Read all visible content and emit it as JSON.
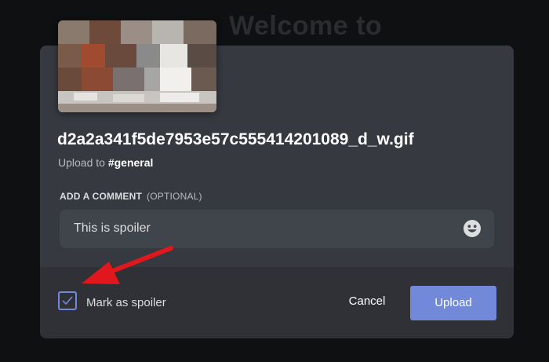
{
  "background": {
    "title": "Welcome to"
  },
  "upload": {
    "filename": "d2a2a341f5de7953e57c555414201089_d_w.gif",
    "destination_prefix": "Upload to",
    "destination_channel": "#general"
  },
  "comment": {
    "label": "ADD A COMMENT",
    "optional_label": "(OPTIONAL)",
    "value": "This is spoiler",
    "emoji_icon": "smiley-emoji-icon"
  },
  "spoiler": {
    "label": "Mark as spoiler",
    "checked": true
  },
  "actions": {
    "cancel_label": "Cancel",
    "upload_label": "Upload"
  },
  "colors": {
    "accent": "#7289da",
    "annotation_arrow": "#e0171c",
    "modal_bg": "#36393f",
    "footer_bg": "#2f3136",
    "input_bg": "#40444b"
  }
}
